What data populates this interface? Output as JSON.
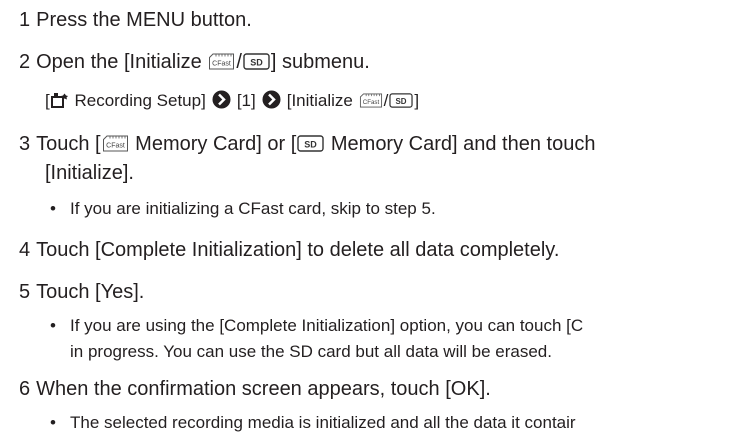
{
  "steps": [
    {
      "num": "1",
      "text": "Press the MENU button."
    },
    {
      "num": "2",
      "text_before": "Open the [Initialize ",
      "text_slash": "/",
      "text_after": "] submenu."
    },
    {
      "num": "3",
      "text_a": "Touch [",
      "text_b": " Memory Card] or [",
      "text_c": " Memory Card] and then touch",
      "text_cont": "[Initialize]."
    },
    {
      "num": "4",
      "text": "Touch [Complete Initialization] to delete all data completely."
    },
    {
      "num": "5",
      "text": "Touch [Yes]."
    },
    {
      "num": "6",
      "text": "When the confirmation screen appears, touch [OK]."
    }
  ],
  "menu_path": {
    "open_bracket": "[",
    "setup_label": " Recording Setup]",
    "item_1": "[1]",
    "initialize_before": "[Initialize ",
    "initialize_slash": "/",
    "initialize_after": "]"
  },
  "bullets": {
    "step3": "If you are initializing a CFast card, skip to step 5.",
    "step5_line1": "If you are using the [Complete Initialization] option, you can touch [C",
    "step5_line2": "in progress. You can use the SD card but all data will be erased.",
    "step6": "The selected recording media is initialized and all the data it contair"
  },
  "icons": {
    "cfast": "CFast",
    "sd": "SD",
    "camera_icon": "camera-setup-icon",
    "arrow_icon": "chevron-right-circle-icon"
  },
  "bullet_char": "•"
}
